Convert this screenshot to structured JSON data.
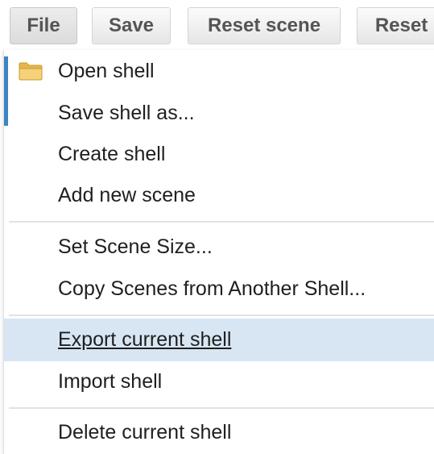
{
  "toolbar": {
    "file_label": "File",
    "save_label": "Save",
    "reset_scene_label": "Reset scene",
    "reset_label": "Reset"
  },
  "menu": {
    "items": [
      {
        "label": "Open shell",
        "icon": "folder-icon"
      },
      {
        "label": "Save shell as..."
      },
      {
        "label": "Create shell"
      },
      {
        "label": "Add new scene"
      },
      {
        "label": "Set Scene Size..."
      },
      {
        "label": "Copy Scenes from Another Shell..."
      },
      {
        "label": "Export current shell",
        "highlighted": true
      },
      {
        "label": "Import shell"
      },
      {
        "label": "Delete current shell"
      }
    ]
  },
  "colors": {
    "accent": "#3c84c4",
    "highlight": "#d8e6f4",
    "folder": "#f2c35a"
  }
}
